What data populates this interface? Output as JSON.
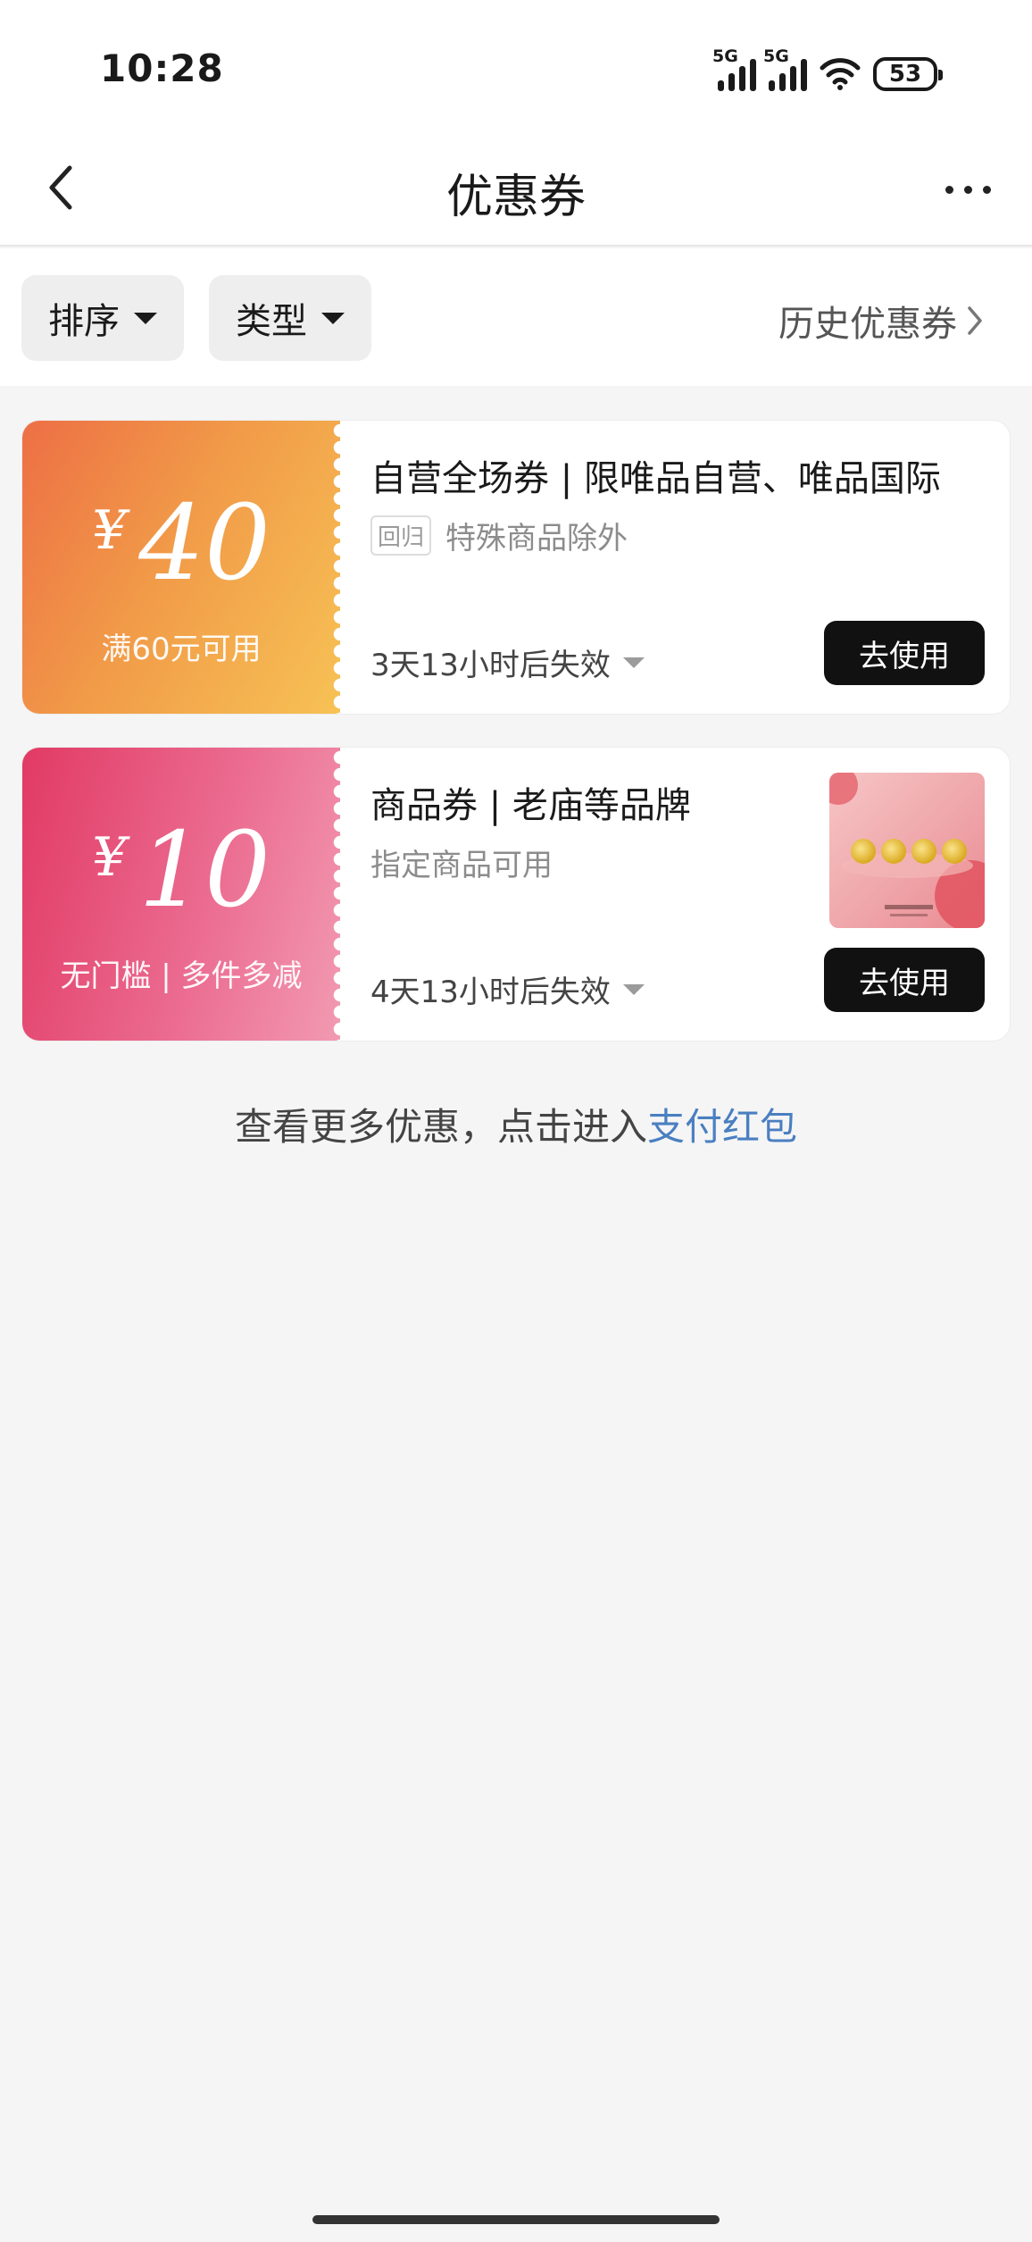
{
  "status_bar": {
    "time": "10:28",
    "network_1": "5G",
    "network_2": "5G",
    "battery": "53"
  },
  "nav": {
    "title": "优惠券",
    "back_icon": "chevron-left-icon",
    "more_icon": "more-dots-icon"
  },
  "filters": {
    "sort_label": "排序",
    "type_label": "类型",
    "history_label": "历史优惠券"
  },
  "coupons": [
    {
      "currency": "¥",
      "amount": "40",
      "condition": "满60元可用",
      "title": "自营全场券 | 限唯品自营、唯品国际",
      "tag": "回归",
      "note": "特殊商品除外",
      "expiry": "3天13小时后失效",
      "button": "去使用",
      "color": "#ef8a47"
    },
    {
      "currency": "¥",
      "amount": "10",
      "condition": "无门槛 | 多件多减",
      "title": "商品券 | 老庙等品牌",
      "note": "指定商品可用",
      "expiry": "4天13小时后失效",
      "button": "去使用",
      "color": "#e44d78"
    }
  ],
  "footer": {
    "text": "查看更多优惠，点击进入",
    "link": "支付红包",
    "link_color": "#4a7fc1"
  }
}
